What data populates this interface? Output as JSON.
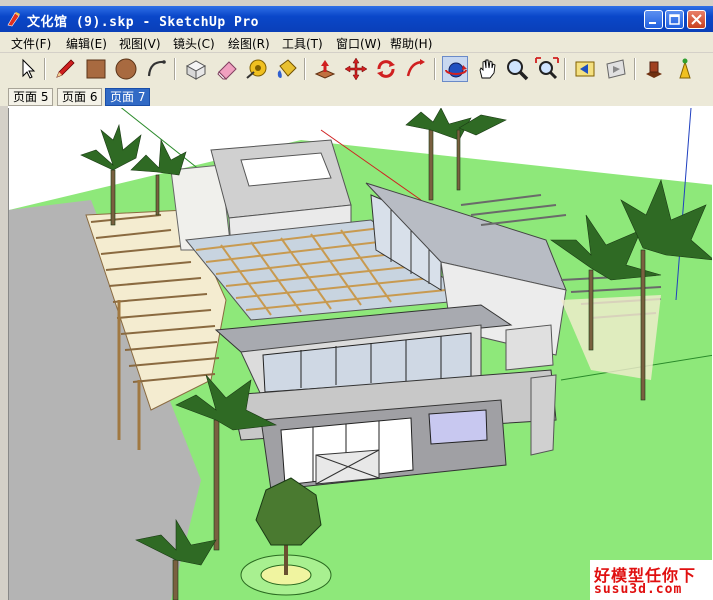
{
  "window": {
    "title": "文化馆 (9).skp - SketchUp Pro"
  },
  "menu": [
    {
      "label": "文件(F)"
    },
    {
      "label": "编辑(E)"
    },
    {
      "label": "视图(V)"
    },
    {
      "label": "镜头(C)"
    },
    {
      "label": "绘图(R)"
    },
    {
      "label": "工具(T)"
    },
    {
      "label": "窗口(W)"
    },
    {
      "label": "帮助(H)"
    }
  ],
  "toolbar": {
    "tools": [
      "select-icon",
      "pencil-icon",
      "rectangle-icon",
      "circle-icon",
      "arc-icon",
      "make-component-icon",
      "eraser-icon",
      "tape-measure-icon",
      "paint-bucket-icon",
      "push-pull-icon",
      "move-icon",
      "rotate-icon",
      "follow-me-icon",
      "orbit-icon",
      "pan-icon",
      "zoom-icon",
      "zoom-extents-icon",
      "previous-view-icon",
      "next-view-icon",
      "component-browser-icon",
      "get-models-icon"
    ],
    "active_tool": "orbit-icon"
  },
  "tabs": [
    {
      "label": "页面 5",
      "active": false
    },
    {
      "label": "页面 6",
      "active": false
    },
    {
      "label": "页面 7",
      "active": true
    }
  ],
  "watermark": {
    "line1": "好模型任你下",
    "line2": "susu3d.com"
  },
  "colors": {
    "titlebar": "#0a47c9",
    "menubar": "#ece9d8",
    "ground": "#8ee87a",
    "accent_tab": "#316ac5",
    "watermark": "#e01010"
  }
}
